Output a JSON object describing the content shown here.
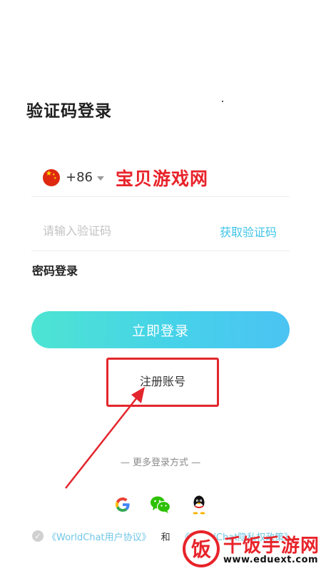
{
  "header": {
    "title": "验证码登录"
  },
  "phone": {
    "flag_icon": "china-flag-icon",
    "country_code": "+86",
    "overlay_text": "宝贝游戏网",
    "overlay_color": "#e8232a"
  },
  "verify": {
    "placeholder": "请输入验证码",
    "get_code_label": "获取验证码",
    "link_color": "#3fc4e8"
  },
  "password_login_label": "密码登录",
  "login_button_label": "立即登录",
  "register_label": "注册账号",
  "annotation_color": "#e3262d",
  "more_login_label": "— 更多登录方式 —",
  "social_icons": [
    "google-icon",
    "wechat-icon",
    "qq-icon"
  ],
  "agreement": {
    "user_agreement": "《WorldChat用户协议》",
    "and": "和",
    "privacy_policy": "《WorldChat隐私权政策》"
  },
  "watermark": {
    "title": "千饭手游网",
    "url": "www.eduext.com",
    "logo_char": "饭"
  }
}
